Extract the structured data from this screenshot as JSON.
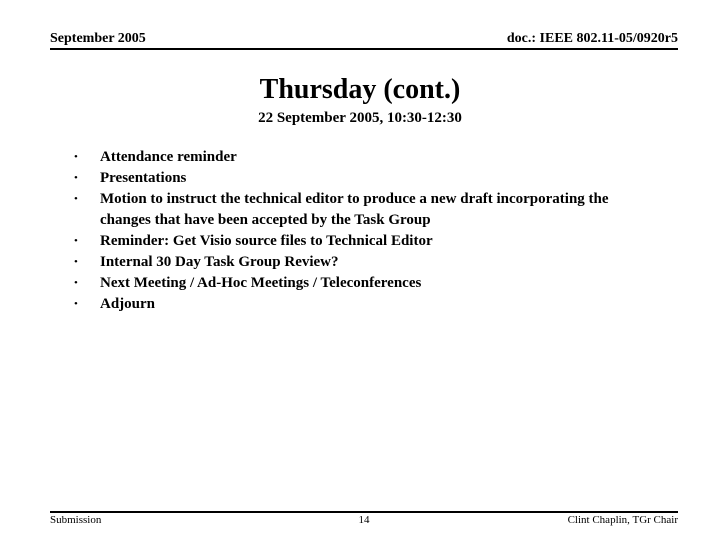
{
  "header": {
    "left": "September 2005",
    "right": "doc.: IEEE 802.11-05/0920r5"
  },
  "title": "Thursday (cont.)",
  "subtitle": "22 September 2005, 10:30-12:30",
  "bullets": [
    "Attendance reminder",
    "Presentations",
    "Motion to instruct the technical editor to produce a new draft incorporating the changes that have been accepted by the Task Group",
    "Reminder: Get Visio source files to Technical Editor",
    "Internal 30 Day Task Group Review?",
    "Next Meeting / Ad-Hoc Meetings / Teleconferences",
    "Adjourn"
  ],
  "footer": {
    "left": "Submission",
    "page": "14",
    "right": "Clint Chaplin, TGr Chair"
  },
  "colors": {
    "text": "#000000",
    "background": "#ffffff",
    "rule": "#000000"
  }
}
